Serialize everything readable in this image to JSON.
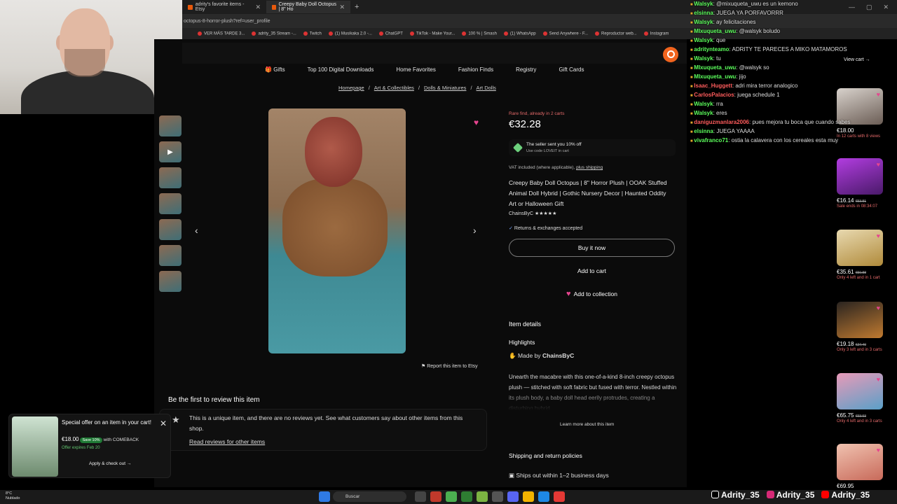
{
  "browser": {
    "tabs": [
      "adrity's favorite items - Etsy",
      "Creepy Baby Doll Octopus | 8\" Ho"
    ],
    "url": "octopus-8-horror-plush?ref=user_profile",
    "bookmarks": [
      "VER MÁS TARDE 3...",
      "adrity_35 Stream -...",
      "Twitch",
      "(1) Musikaka 2.0 -...",
      "ChatGPT",
      "TikTok - Make Your...",
      "100 % | Smash",
      "(1) WhatsApp",
      "Send Anywhere - F...",
      "Reproductor web...",
      "Instagram"
    ]
  },
  "nav": [
    "Gifts",
    "Top 100 Digital Downloads",
    "Home Favorites",
    "Fashion Finds",
    "Registry",
    "Gift Cards"
  ],
  "breadcrumb": [
    "Homepage",
    "Art & Collectibles",
    "Dolls & Miniatures",
    "Art Dolls"
  ],
  "product": {
    "rare": "Rare find, already in 2 carts",
    "price": "€32.28",
    "coupon_title": "The seller sent you 10% off",
    "coupon_code": "Use code LOVEIT in cart",
    "vat": "VAT included (where applicable),",
    "vat_link": "plus shipping",
    "title": "Creepy Baby Doll Octopus | 8\" Horror Plush | OOAK Stuffed Animal Doll Hybrid | Gothic Nursery Decor | Haunted Oddity Art or Halloween Gift",
    "shop": "ChainsByC",
    "stars": "★★★★★",
    "returns": "Returns & exchanges accepted",
    "buy_now": "Buy it now",
    "add_cart": "Add to cart",
    "add_collection": "Add to collection",
    "item_details": "Item details",
    "highlights": "Highlights",
    "made_by": "Made by",
    "desc": "Unearth the macabre with this one-of-a-kind 8-inch creepy octopus plush — stitched with soft fabric but fused with terror. Nestled within its plush body, a baby doll head eerily protrudes, creating a disturbing hybrid",
    "learn_more": "Learn more about this item",
    "shipping_title": "Shipping and return policies",
    "ships": "Ships out within 1–2 business days",
    "report": "Report this item to Etsy"
  },
  "reviews": {
    "title": "Be the first to review this item",
    "text": "This is a unique item, and there are no reviews yet. See what customers say about other items from this shop.",
    "link": "Read reviews for other items"
  },
  "offer": {
    "title": "Special offer on an item in your cart!",
    "price": "€18.00",
    "save": "Save 10%",
    "code": "with COMEBACK",
    "expires": "Offer expires Feb 20",
    "action": "Apply & check out →"
  },
  "chat": [
    {
      "user": "Walsyk",
      "color": "#5cff5c",
      "text": ": @mixuqueta_uwu es un kemono"
    },
    {
      "user": "elsinna",
      "color": "#ff5c5c",
      "text": ": JUEGA YA PORFAVORRR"
    },
    {
      "user": "Walsyk",
      "color": "#5cff5c",
      "text": ": ay felicitaciones"
    },
    {
      "user": "MIxuqueta_uwu",
      "color": "#5cff5c",
      "text": ": @walsyk boludo"
    },
    {
      "user": "Walsyk",
      "color": "#5cff5c",
      "text": ": que"
    },
    {
      "user": "adritynteamo",
      "color": "#5cff5c",
      "text": ": ADRITY TE PARECES A MIKO MATAMOROS"
    },
    {
      "user": "Walsyk",
      "color": "#5cff5c",
      "text": ": tu"
    },
    {
      "user": "MIxuqueta_uwu",
      "color": "#5cff5c",
      "text": ": @walsyk so"
    },
    {
      "user": "MIxuqueta_uwu",
      "color": "#5cff5c",
      "text": ": jijo"
    },
    {
      "user": "Isaac_Huggett",
      "color": "#ff5c5c",
      "text": ": adri mira terror analogico"
    },
    {
      "user": "CarlosPalacios",
      "color": "#ff5c5c",
      "text": ": juega schedule 1"
    },
    {
      "user": "Walsyk",
      "color": "#5cff5c",
      "text": ": rra"
    },
    {
      "user": "Walsyk",
      "color": "#5cff5c",
      "text": ": eres"
    },
    {
      "user": "daniguzmanlara2006",
      "color": "#ff5c5c",
      "text": ": pues mejora tu boca que cuando sabes"
    },
    {
      "user": "elsinna",
      "color": "#5cff5c",
      "text": ": JUEGA YAAAA"
    },
    {
      "user": "vivafranco71",
      "color": "#5cff5c",
      "text": ": ostia la calavera con los cereales esta muy"
    }
  ],
  "sidebar": {
    "view_cart": "View cart →",
    "cards": [
      {
        "price": "€18.00",
        "old": "",
        "note": "In 12 carts with 8 views"
      },
      {
        "price": "€16.14",
        "old": "€53.81",
        "note": "Sale ends in 08:34:07"
      },
      {
        "price": "€35.61",
        "old": "€50.88",
        "note": "Only 4 left and in 1 cart"
      },
      {
        "price": "€19.18",
        "old": "€27.40",
        "note": "Only 3 left and in 3 carts"
      },
      {
        "price": "€65.75",
        "old": "€93.93",
        "note": "Only 4 left and in 3 carts"
      },
      {
        "price": "€69.95",
        "old": "",
        "note": ""
      }
    ]
  },
  "taskbar": {
    "temp": "8°C",
    "weather": "Nublado",
    "search": "Buscar",
    "socials": [
      "Adrity_35",
      "Adrity_35",
      "Adrity_35"
    ]
  }
}
